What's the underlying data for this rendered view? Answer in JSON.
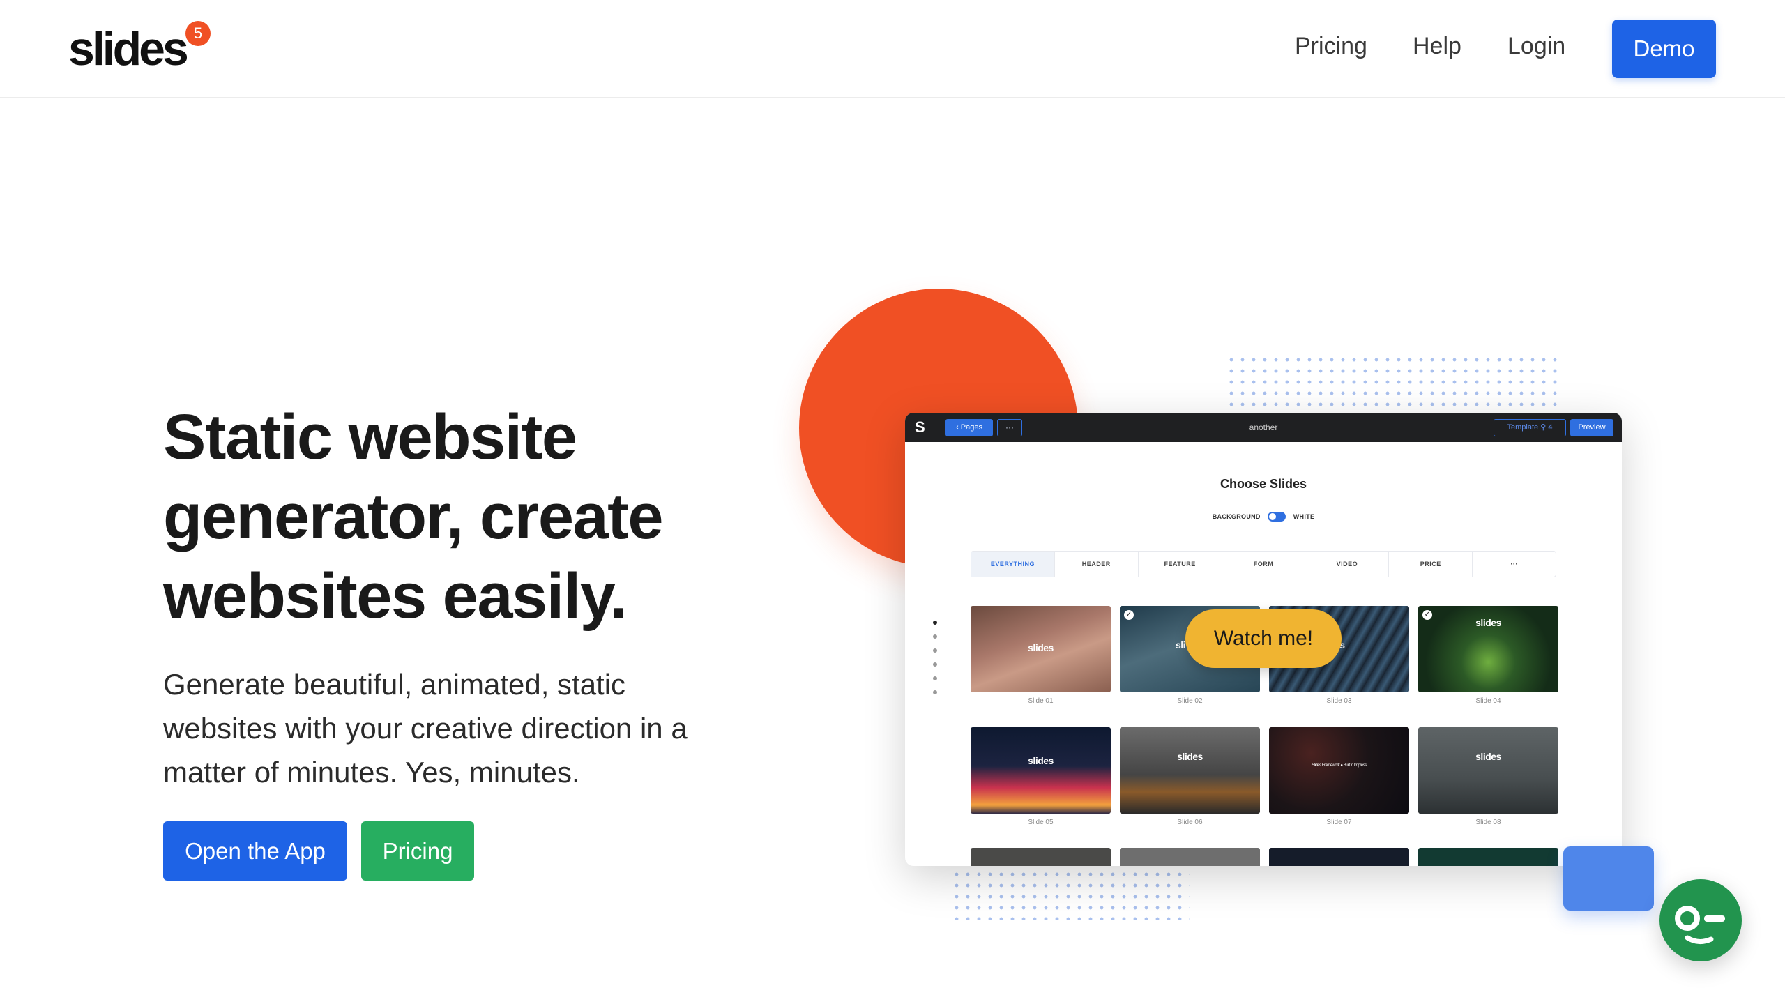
{
  "header": {
    "logo_text": "slides",
    "logo_badge": "5",
    "nav": [
      "Pricing",
      "Help",
      "Login"
    ],
    "demo_label": "Demo"
  },
  "hero": {
    "title_lines": [
      "Static website",
      "generator, create",
      "websites easily."
    ],
    "subtitle_lines": [
      "Generate beautiful, animated, static",
      "websites with your creative direction in a",
      "matter of minutes. Yes, minutes."
    ],
    "primary_cta": "Open the App",
    "secondary_cta": "Pricing"
  },
  "preview": {
    "logo": "S",
    "pages_btn": "‹  Pages",
    "more_btn": "···",
    "doc_title": "another",
    "template_btn": "Template ⚲ 4",
    "preview_btn": "Preview",
    "heading": "Choose Slides",
    "bg_label": "BACKGROUND",
    "bg_value": "WHITE",
    "tabs": [
      "EVERYTHING",
      "HEADER",
      "FEATURE",
      "FORM",
      "VIDEO",
      "PRICE",
      "···"
    ],
    "slides": [
      {
        "label": "Slide 01",
        "brand": "slides",
        "checked": false
      },
      {
        "label": "Slide 02",
        "brand": "sli",
        "checked": true
      },
      {
        "label": "Slide 03",
        "brand": "es",
        "checked": false
      },
      {
        "label": "Slide 04",
        "brand": "slides",
        "checked": true
      },
      {
        "label": "Slide 05",
        "brand": "slides",
        "checked": false
      },
      {
        "label": "Slide 06",
        "brand": "slides",
        "checked": false
      },
      {
        "label": "Slide 07",
        "brand": "Slides Framework  ●  Built in Impress",
        "checked": false
      },
      {
        "label": "Slide 08",
        "brand": "slides",
        "checked": false
      }
    ],
    "watch_label": "Watch me!"
  },
  "colors": {
    "accent_blue": "#1e63e6",
    "accent_green": "#27ae60",
    "accent_orange": "#f05024",
    "accent_yellow": "#f0b431",
    "chat_green": "#22944e"
  },
  "icons": [
    "chat-icon",
    "check-icon",
    "chevron-left-icon"
  ]
}
